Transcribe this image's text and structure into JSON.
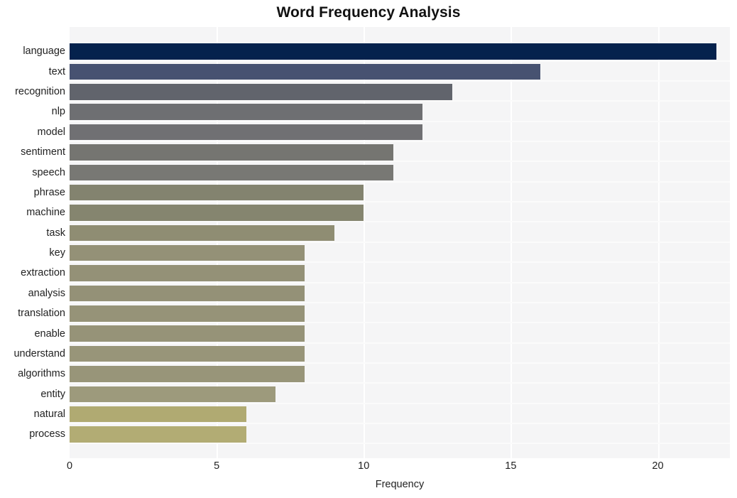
{
  "chart_data": {
    "type": "bar",
    "orientation": "horizontal",
    "title": "Word Frequency Analysis",
    "xlabel": "Frequency",
    "ylabel": "",
    "xlim": [
      0,
      22.45
    ],
    "xticks": [
      0,
      5,
      10,
      15,
      20
    ],
    "xtick_labels": [
      "0",
      "5",
      "10",
      "15",
      "20"
    ],
    "grid": true,
    "grid_color": "#ffffff",
    "plot_background": "#f5f5f6",
    "legend": false,
    "categories": [
      "language",
      "text",
      "recognition",
      "nlp",
      "model",
      "sentiment",
      "speech",
      "phrase",
      "machine",
      "task",
      "key",
      "extraction",
      "analysis",
      "translation",
      "enable",
      "understand",
      "algorithms",
      "entity",
      "natural",
      "process"
    ],
    "values": [
      22,
      16,
      13,
      12,
      12,
      11,
      11,
      10,
      10,
      9,
      8,
      8,
      8,
      8,
      8,
      8,
      8,
      7,
      6,
      6
    ],
    "bar_colors": [
      "#05224d",
      "#475271",
      "#61646c",
      "#6e6f72",
      "#707073",
      "#757571",
      "#787874",
      "#83836f",
      "#85856f",
      "#8f8d73",
      "#949177",
      "#949177",
      "#949177",
      "#969378",
      "#969378",
      "#989579",
      "#989579",
      "#9d9a7c",
      "#b0aa72",
      "#b2ac74"
    ]
  }
}
